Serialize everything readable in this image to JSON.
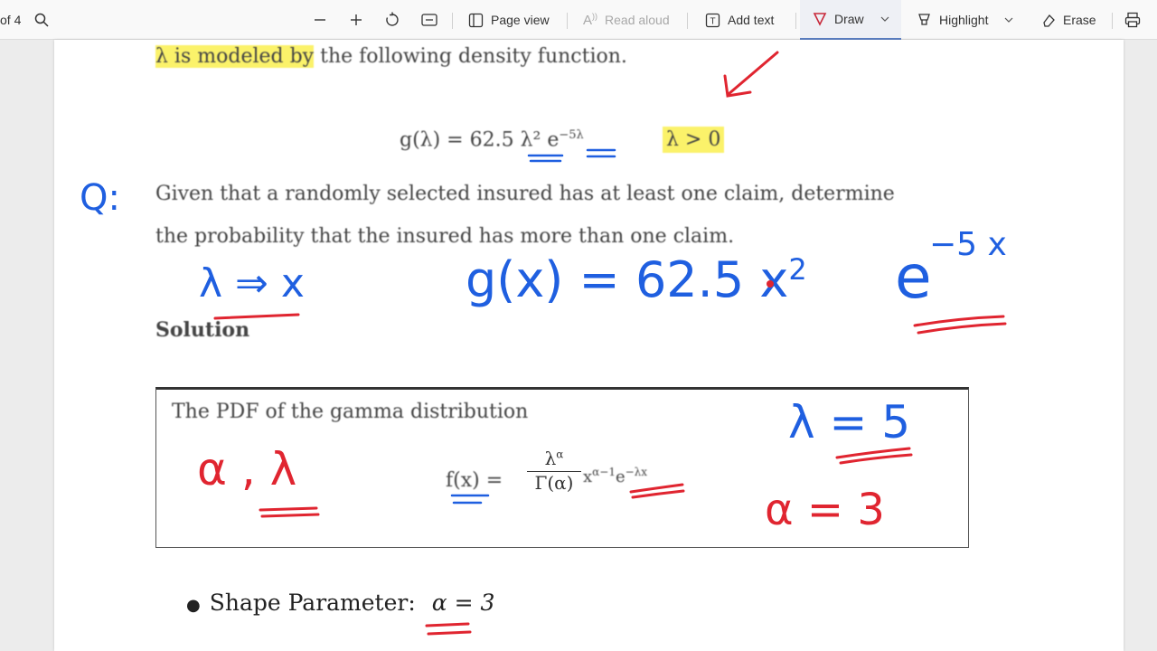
{
  "toolbar": {
    "page_count": "of 4",
    "page_view": "Page view",
    "read_aloud": "Read aloud",
    "add_text": "Add text",
    "draw": "Draw",
    "highlight": "Highlight",
    "erase": "Erase"
  },
  "document": {
    "line1_highlighted": "λ is modeled by",
    "line1_rest": " the following density function.",
    "formula_lhs": "g(λ) = 62.5 λ² e",
    "formula_exp": "−5λ",
    "formula_cond": "λ > 0",
    "question_line1": "Given that a randomly selected insured has at least one claim, determine",
    "question_line2": "the probability that the insured has more than one claim.",
    "solution_heading": "Solution",
    "box_title": "The PDF of the gamma distribution",
    "box_formula_lhs": "f(x) =",
    "box_formula_num": "λ",
    "box_formula_num_exp": "α",
    "box_formula_den": "Γ(α)",
    "box_formula_tail": "x",
    "box_formula_tail_exp": "α−1",
    "box_formula_e": "e",
    "box_formula_e_exp": "−λx",
    "bullet_label": "Shape Parameter:",
    "bullet_value": "α = 3"
  },
  "annotations": {
    "q_mark": "Q:",
    "substitution": "λ ⇒ x",
    "handwritten_formula": "g(x) = 62.5 x",
    "handwritten_formula_sup2": "2",
    "handwritten_e": "e",
    "handwritten_exp": "−5 x",
    "params": "α , λ",
    "lambda_value": "λ = 5",
    "alpha_value": "α = 3"
  },
  "colors": {
    "ink_blue": "#1f5fe0",
    "ink_red": "#e02530",
    "highlight_yellow": "#fbf26a",
    "draw_accent": "#c8283a"
  }
}
